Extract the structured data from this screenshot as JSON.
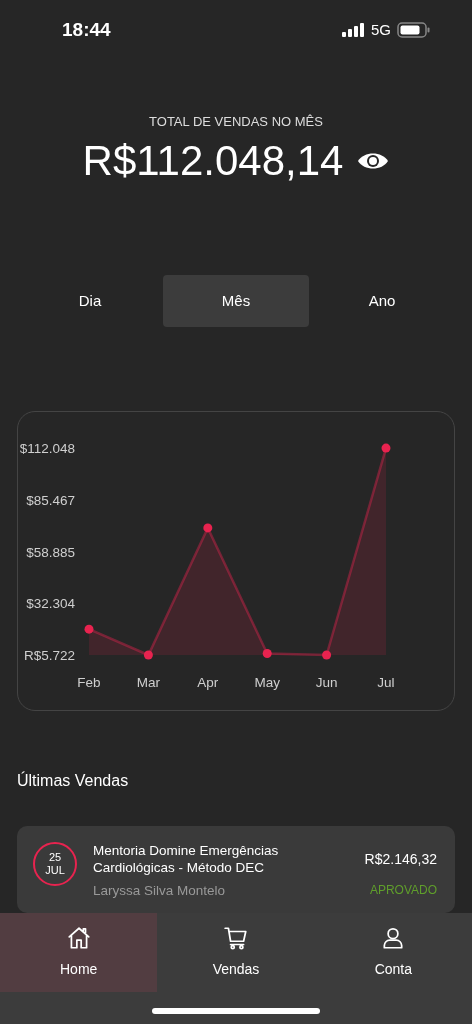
{
  "status_bar": {
    "time": "18:44",
    "network": "5G"
  },
  "summary": {
    "label": "TOTAL DE VENDAS NO MÊS",
    "amount": "R$112.048,14"
  },
  "period_tabs": [
    {
      "label": "Dia",
      "selected": false
    },
    {
      "label": "Mês",
      "selected": true
    },
    {
      "label": "Ano",
      "selected": false
    }
  ],
  "chart": {
    "chart_data": {
      "type": "area",
      "categories": [
        "Feb",
        "Mar",
        "Apr",
        "May",
        "Jun",
        "Jul"
      ],
      "series": [
        {
          "color": "#e8234f",
          "values": [
            19000,
            5722,
            71000,
            6500,
            5722,
            112000
          ]
        }
      ],
      "ylim": [
        5722,
        112048
      ],
      "yticks": [
        {
          "value": 112048,
          "label": "$112.048"
        },
        {
          "value": 85467,
          "label": "$85.467"
        },
        {
          "value": 58885,
          "label": "$58.885"
        },
        {
          "value": 32304,
          "label": "$32.304"
        },
        {
          "value": 5722,
          "label": "R$5.722"
        }
      ]
    }
  },
  "recent_sales": {
    "title": "Últimas Vendas",
    "items": [
      {
        "day": "25",
        "month": "JUL",
        "product": "Mentoria Domine Emergências Cardiológicas - Método DEC",
        "amount": "R$2.146,32",
        "customer": "Laryssa Silva Montelo",
        "status": "APROVADO",
        "color": "#5f9e2b"
      }
    ]
  },
  "bottom_nav": [
    {
      "kind": "home",
      "label": "Home",
      "selected": true
    },
    {
      "kind": "cart",
      "label": "Vendas",
      "selected": false
    },
    {
      "kind": "user",
      "label": "Conta",
      "selected": false
    }
  ]
}
